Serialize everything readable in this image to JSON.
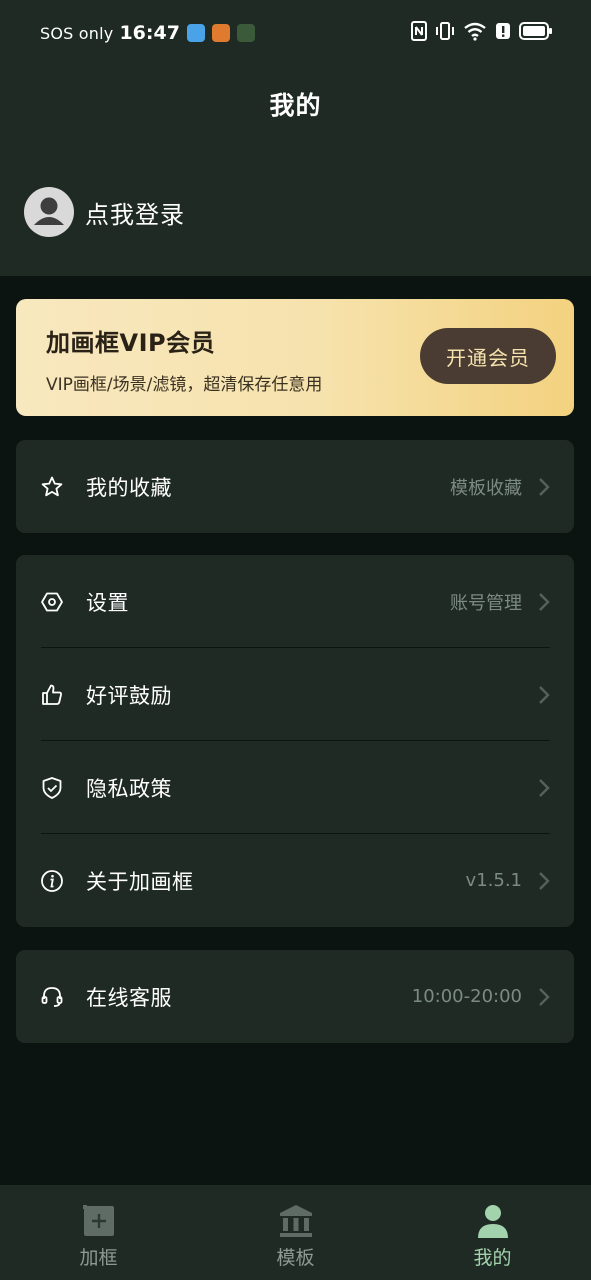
{
  "status_bar": {
    "carrier": "SOS only",
    "time": "16:47",
    "app_icons": [
      "weather-app-icon",
      "puzzle-app-icon",
      "game-app-icon"
    ],
    "system_icons": [
      "nfc-icon",
      "vibrate-icon",
      "wifi-icon",
      "alert-icon",
      "battery-icon"
    ]
  },
  "header": {
    "title": "我的",
    "login_text": "点我登录"
  },
  "vip": {
    "title": "加画框VIP会员",
    "subtitle": "VIP画框/场景/滤镜，超清保存任意用",
    "button": "开通会员"
  },
  "favorites": {
    "label": "我的收藏",
    "value": "模板收藏",
    "icon": "star-icon"
  },
  "menu": [
    {
      "label": "设置",
      "value": "账号管理",
      "icon": "settings-icon"
    },
    {
      "label": "好评鼓励",
      "value": "",
      "icon": "thumbs-up-icon"
    },
    {
      "label": "隐私政策",
      "value": "",
      "icon": "shield-check-icon"
    },
    {
      "label": "关于加画框",
      "value": "v1.5.1",
      "icon": "info-icon"
    }
  ],
  "service": {
    "label": "在线客服",
    "value": "10:00-20:00",
    "icon": "headset-icon"
  },
  "tabs": [
    {
      "label": "加框",
      "icon": "frame-add-icon",
      "active": false
    },
    {
      "label": "模板",
      "icon": "template-icon",
      "active": false
    },
    {
      "label": "我的",
      "icon": "profile-icon",
      "active": true
    }
  ],
  "colors": {
    "background": "#0b1411",
    "surface": "#1f2a25",
    "accent_active": "#a3d3ad",
    "vip_gradient_start": "#f8e8bf",
    "vip_gradient_end": "#f3d27f",
    "vip_button": "#4a3c32",
    "muted_text": "#7c8a84"
  }
}
